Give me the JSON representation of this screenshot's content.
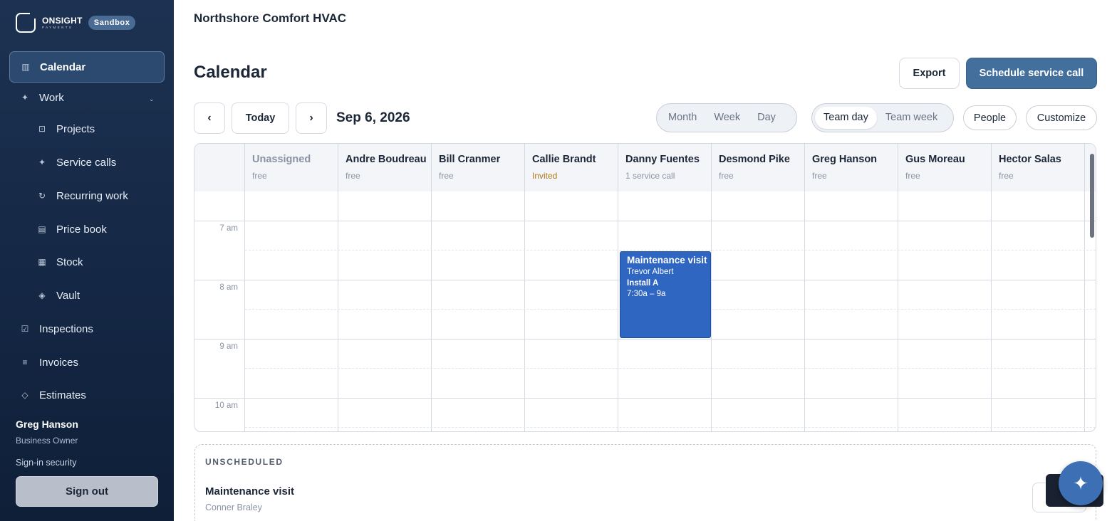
{
  "brand": {
    "name": "ONSIGHT",
    "sub": "PAYMENTS",
    "badge": "Sandbox"
  },
  "sidebar": {
    "items": [
      {
        "label": "Calendar",
        "icon": "calendar-columns-icon",
        "glyph": "▥"
      },
      {
        "label": "Work",
        "icon": "sparkle-icon",
        "glyph": "✦"
      },
      {
        "label": "Projects",
        "icon": "projects-icon",
        "glyph": "⊡"
      },
      {
        "label": "Service calls",
        "icon": "sparkle-icon",
        "glyph": "✦"
      },
      {
        "label": "Recurring work",
        "icon": "refresh-icon",
        "glyph": "↻"
      },
      {
        "label": "Price book",
        "icon": "book-icon",
        "glyph": "▤"
      },
      {
        "label": "Stock",
        "icon": "grid-icon",
        "glyph": "▦"
      },
      {
        "label": "Vault",
        "icon": "diamond-icon",
        "glyph": "◈"
      },
      {
        "label": "Inspections",
        "icon": "checkbox-icon",
        "glyph": "☑"
      },
      {
        "label": "Invoices",
        "icon": "list-icon",
        "glyph": "≡"
      },
      {
        "label": "Estimates",
        "icon": "diamond-outline-icon",
        "glyph": "◇"
      }
    ],
    "work_chevron": "⌄"
  },
  "user": {
    "name": "Greg Hanson",
    "role": "Business Owner",
    "security": "Sign-in security",
    "signout": "Sign out"
  },
  "header": {
    "org": "Northshore Comfort HVAC"
  },
  "page": {
    "title": "Calendar",
    "export": "Export",
    "schedule": "Schedule service call"
  },
  "toolbar": {
    "prev": "‹",
    "today": "Today",
    "next": "›",
    "date": "Sep 6, 2026",
    "views": [
      "Month",
      "Week",
      "Day"
    ],
    "team_views": [
      "Team day",
      "Team week"
    ],
    "team_active": "Team day",
    "people": "People",
    "customize": "Customize"
  },
  "calendar": {
    "columns": [
      {
        "name": "Unassigned",
        "status": "free"
      },
      {
        "name": "Andre Boudreau",
        "status": "free"
      },
      {
        "name": "Bill Cranmer",
        "status": "free"
      },
      {
        "name": "Callie Brandt",
        "status": "Invited"
      },
      {
        "name": "Danny Fuentes",
        "status": "1 service call"
      },
      {
        "name": "Desmond Pike",
        "status": "free"
      },
      {
        "name": "Greg Hanson",
        "status": "free"
      },
      {
        "name": "Gus Moreau",
        "status": "free"
      },
      {
        "name": "Hector Salas",
        "status": "free"
      }
    ],
    "hours": [
      "7 am",
      "8 am",
      "9 am",
      "10 am"
    ],
    "event": {
      "title": "Maintenance visit",
      "customer": "Trevor Albert",
      "equipment": "Install A",
      "time": "7:30a – 9a",
      "color": "#2f66c2"
    }
  },
  "unscheduled": {
    "label": "UNSCHEDULED",
    "item_title": "Maintenance visit",
    "item_customer": "Conner Braley"
  },
  "colors": {
    "sidebar": "#1d3252",
    "accent": "#436f9d",
    "event": "#2f66c2",
    "invited": "#b0791c"
  }
}
